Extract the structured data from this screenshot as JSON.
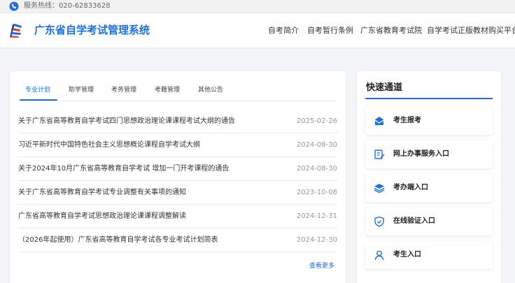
{
  "topbar": {
    "hotline": "服务热线：020-62833628"
  },
  "header": {
    "title": "广东省自学考试管理系统",
    "nav": [
      "自考简介",
      "自考暂行条例",
      "广东省教育考试院",
      "自学考试正版教材购买平台"
    ]
  },
  "news": {
    "tabs": [
      "专业计划",
      "助学管理",
      "考务管理",
      "考籍管理",
      "其他公告"
    ],
    "active_tab": "专业计划",
    "items": [
      {
        "title": "关于广东省高等教育自学考试四门思想政治理论课课程考试大纲的通告",
        "date": "2025-02-26"
      },
      {
        "title": "习近平新时代中国特色社会主义思想概论课程自学考试大纲",
        "date": "2024-08-30"
      },
      {
        "title": "关于2024年10月广东省高等教育自学考试 增加一门开考课程的通告",
        "date": "2024-08-30"
      },
      {
        "title": "关于广东省高等教育自学考试专业调整有关事项的通知",
        "date": "2023-10-08"
      },
      {
        "title": "广东省高等教育自学考试思想政治理论课课程调整解读",
        "date": "2024-12-31"
      },
      {
        "title": "（2026年起使用）广东省高等教育自学考试各专业考试计划简表",
        "date": "2024-12-30"
      }
    ],
    "more": "查看更多"
  },
  "quick": {
    "title": "快速通道",
    "items": [
      {
        "label": "考生报考",
        "icon": "mailbox-icon"
      },
      {
        "label": "网上办事服务入口",
        "icon": "document-edit-icon"
      },
      {
        "label": "考办端入口",
        "icon": "layers-icon"
      },
      {
        "label": "在线验证入口",
        "icon": "shield-check-icon"
      },
      {
        "label": "考生入口",
        "icon": "user-icon"
      }
    ]
  },
  "colors": {
    "accent": "#1f6fe0",
    "background": "#f3f5f8"
  }
}
